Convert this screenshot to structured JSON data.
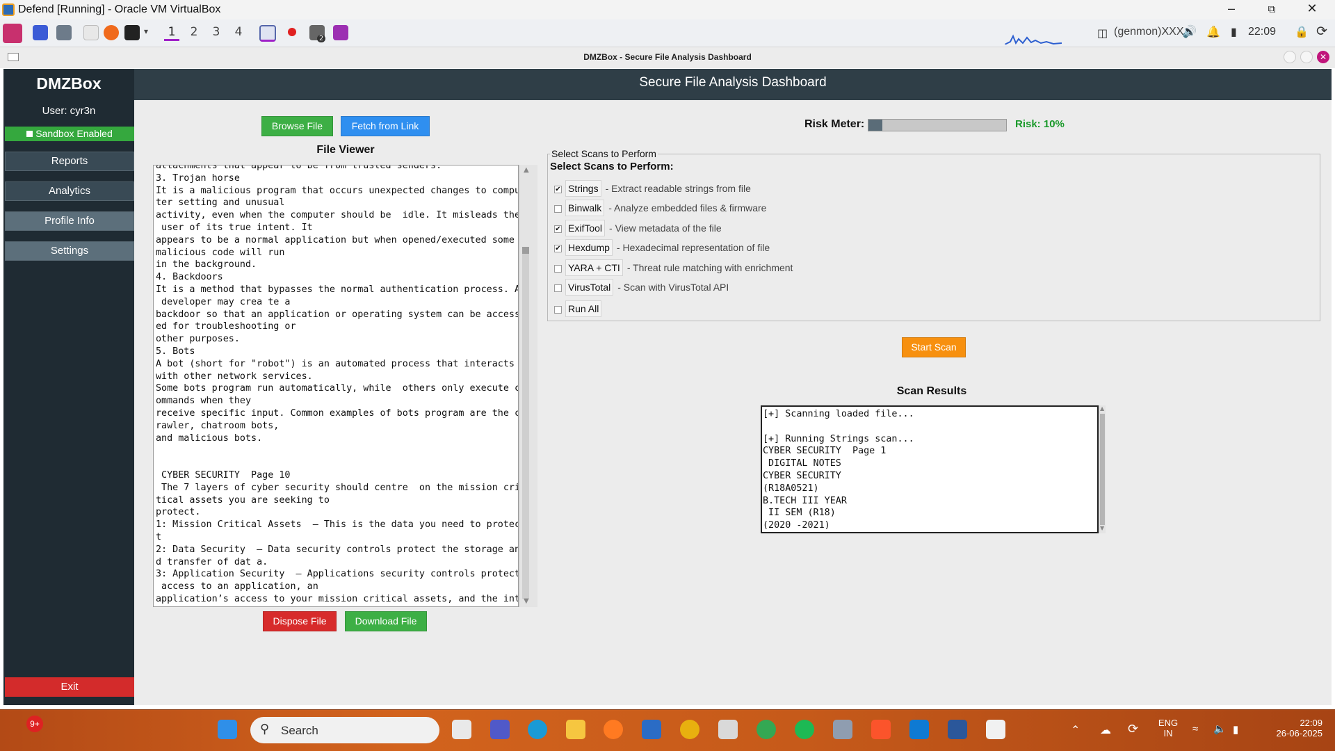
{
  "vm_window": {
    "title": "Defend [Running] - Oracle VM VirtualBox",
    "minimize_icon": "minimize-icon",
    "restore_icon": "restore-icon",
    "close_icon": "close-icon"
  },
  "guest_panel": {
    "workspaces": [
      "1",
      "2",
      "3",
      "4"
    ],
    "active_workspace": "1",
    "genmon": "(genmon)XXX",
    "clock": "22:09",
    "badge": "2"
  },
  "app_window": {
    "title": "DMZBox - Secure File Analysis Dashboard"
  },
  "sidebar": {
    "brand": "DMZBox",
    "user": "User: cyr3n",
    "sandbox_status": "Sandbox Enabled",
    "nav": [
      {
        "label": "Reports"
      },
      {
        "label": "Analytics"
      },
      {
        "label": "Profile Info"
      },
      {
        "label": "Settings"
      }
    ],
    "exit_label": "Exit"
  },
  "header": {
    "title": "Secure File Analysis Dashboard"
  },
  "file_section": {
    "browse_label": "Browse File",
    "fetch_label": "Fetch from Link",
    "viewer_title": "File Viewer",
    "viewer_text": "attachments that appear to be from trusted senders.\n3. Trojan horse\nIt is a malicious program that occurs unexpected changes to compu\nter setting and unusual\nactivity, even when the computer should be  idle. It misleads the\n user of its true intent. It\nappears to be a normal application but when opened/executed some\nmalicious code will run\nin the background.\n4. Backdoors\nIt is a method that bypasses the normal authentication process. A\n developer may crea te a\nbackdoor so that an application or operating system can be access\ned for troubleshooting or\nother purposes.\n5. Bots\nA bot (short for \"robot\") is an automated process that interacts\nwith other network services.\nSome bots program run automatically, while  others only execute c\nommands when they\nreceive specific input. Common examples of bots program are the c\nrawler, chatroom bots,\nand malicious bots.\n\n\n CYBER SECURITY  Page 10\n The 7 layers of cyber security should centre  on the mission cri\ntical assets you are seeking to\nprotect.\n1: Mission Critical Assets  – This is the data you need to protec\nt\n2: Data Security  – Data security controls protect the storage an\nd transfer of dat a.\n3: Application Security  – Applications security controls protect\n access to an application, an\napplication’s access to your mission critical assets, and the int",
    "dispose_label": "Dispose File",
    "download_label": "Download File"
  },
  "risk": {
    "label": "Risk Meter:",
    "value_text": "Risk: 10%",
    "fraction": 0.1,
    "value_color": "#1b9a2b"
  },
  "scans": {
    "frame_title": "Select Scans to Perform",
    "heading": "Select Scans to Perform:",
    "items": [
      {
        "name": "Strings",
        "desc": "- Extract readable strings from file",
        "checked": true
      },
      {
        "name": "Binwalk",
        "desc": "- Analyze embedded files & firmware",
        "checked": false
      },
      {
        "name": "ExifTool",
        "desc": "- View metadata of the file",
        "checked": true
      },
      {
        "name": "Hexdump",
        "desc": "- Hexadecimal representation of file",
        "checked": true
      },
      {
        "name": "YARA + CTI",
        "desc": "- Threat rule matching with enrichment",
        "checked": false
      },
      {
        "name": "VirusTotal",
        "desc": "- Scan with VirusTotal API",
        "checked": false
      }
    ],
    "run_all_label": "Run All",
    "run_all_checked": false,
    "start_label": "Start Scan"
  },
  "results": {
    "title": "Scan Results",
    "text": "[+] Scanning loaded file...\n\n[+] Running Strings scan...\nCYBER SECURITY  Page 1\n DIGITAL NOTES\nCYBER SECURITY\n(R18A0521)\nB.TECH III YEAR\n II SEM (R18)\n(2020 -2021)"
  },
  "taskbar": {
    "notification_badge": "9+",
    "search_placeholder": "Search",
    "lang_line1": "ENG",
    "lang_line2": "IN",
    "time": "22:09",
    "date": "26-06-2025"
  }
}
